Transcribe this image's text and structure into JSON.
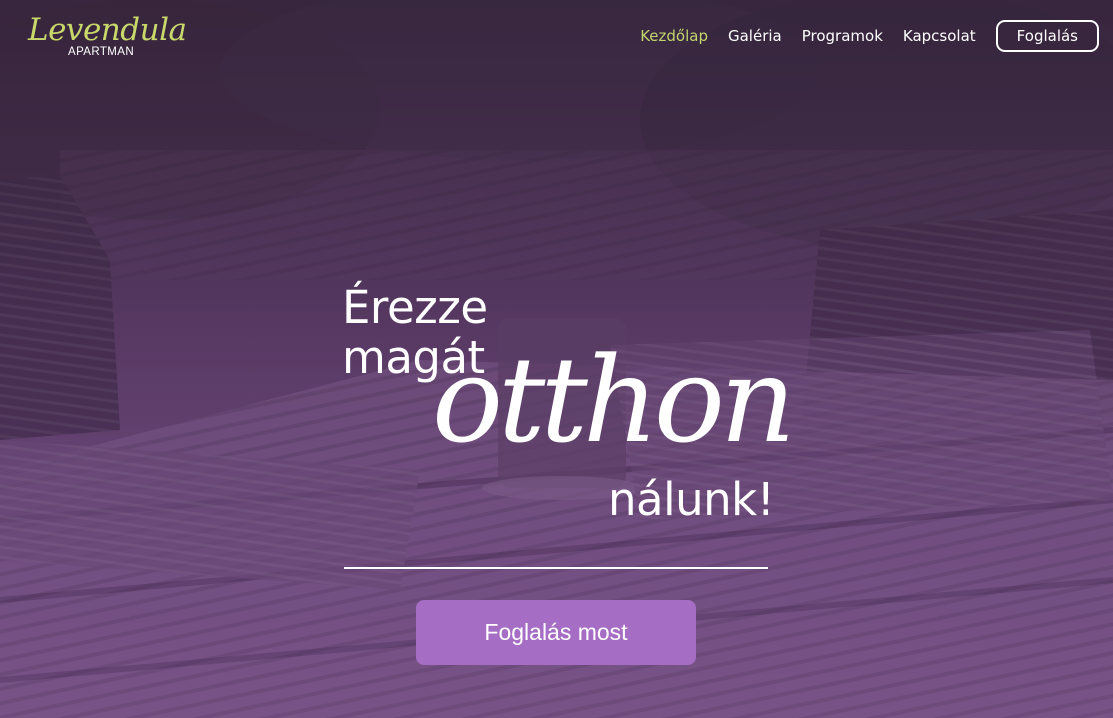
{
  "brand": {
    "script_name": "Levendula",
    "sub_name": "APARTMAN"
  },
  "nav": {
    "items": [
      {
        "label": "Kezdőlap",
        "active": true
      },
      {
        "label": "Galéria",
        "active": false
      },
      {
        "label": "Programok",
        "active": false
      },
      {
        "label": "Kapcsolat",
        "active": false
      }
    ],
    "cta_label": "Foglalás"
  },
  "hero": {
    "line1": "Érezze",
    "line2": "magát",
    "script_word": "otthon",
    "line4": "nálunk!",
    "button_label": "Foglalás most"
  },
  "colors": {
    "accent_green": "#c3d66d",
    "button_purple": "#a66dc4",
    "overlay_purple": "#5a3a66"
  }
}
